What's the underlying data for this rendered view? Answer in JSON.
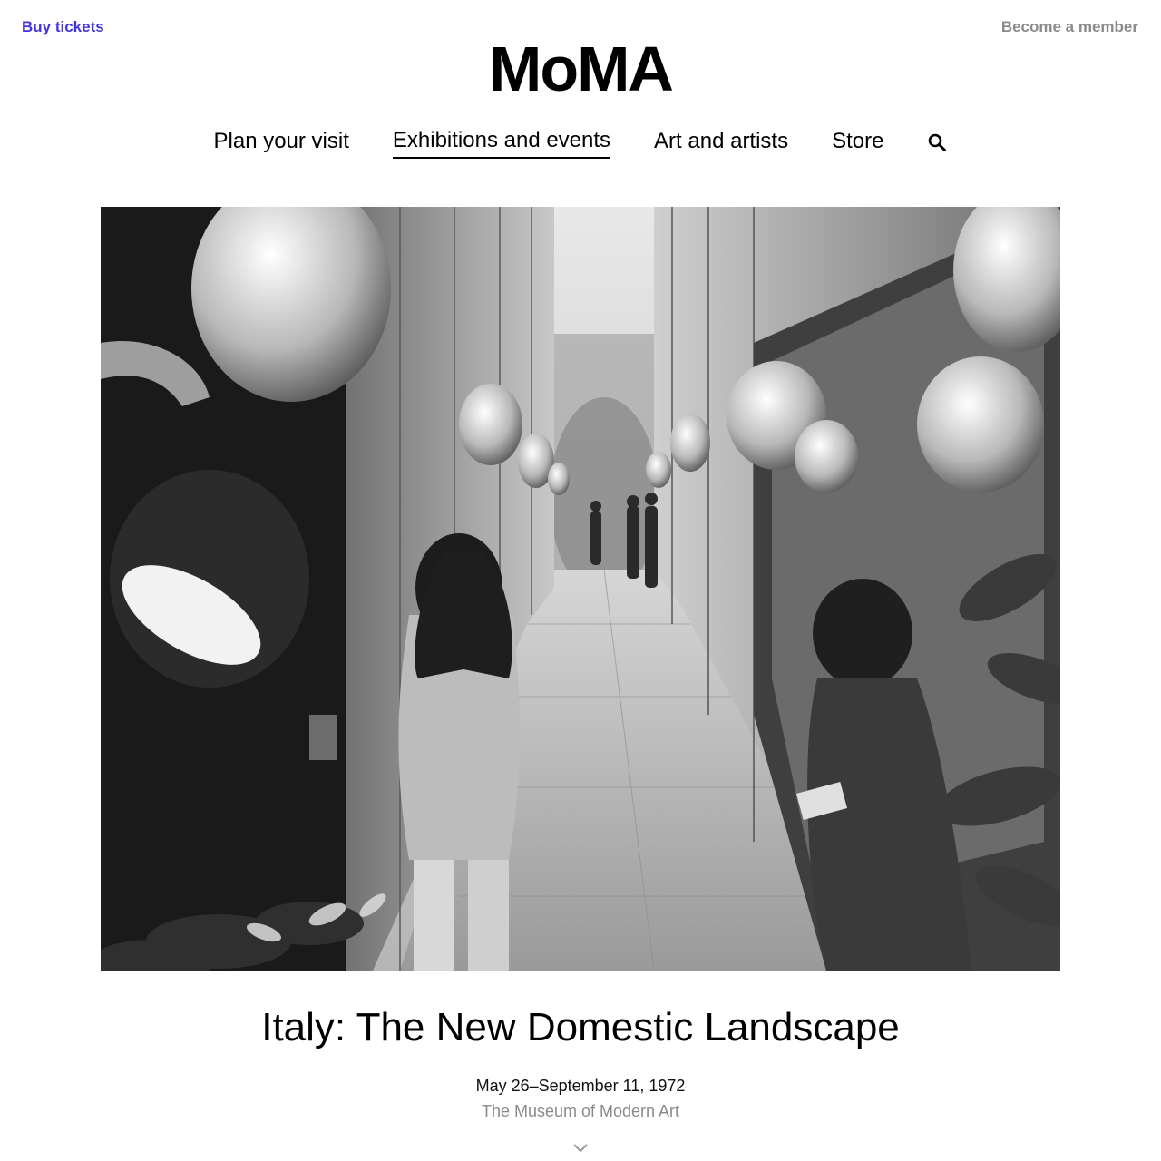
{
  "header": {
    "buy_tickets": "Buy tickets",
    "become_member": "Become a member",
    "logo": "MoMA"
  },
  "nav": {
    "items": [
      {
        "label": "Plan your visit",
        "active": false
      },
      {
        "label": "Exhibitions and events",
        "active": true
      },
      {
        "label": "Art and artists",
        "active": false
      },
      {
        "label": "Store",
        "active": false
      }
    ],
    "search_icon": "search-icon"
  },
  "hero": {
    "image": "black-and-white exhibition photograph"
  },
  "exhibition": {
    "title": "Italy: The New Domestic Landscape",
    "dates": "May 26–September 11, 1972",
    "venue": "The Museum of Modern Art"
  },
  "scroll_icon": "chevron-down-icon",
  "colors": {
    "link_accent": "#4433e0",
    "muted_text": "#8a8a8a",
    "text": "#000000"
  }
}
